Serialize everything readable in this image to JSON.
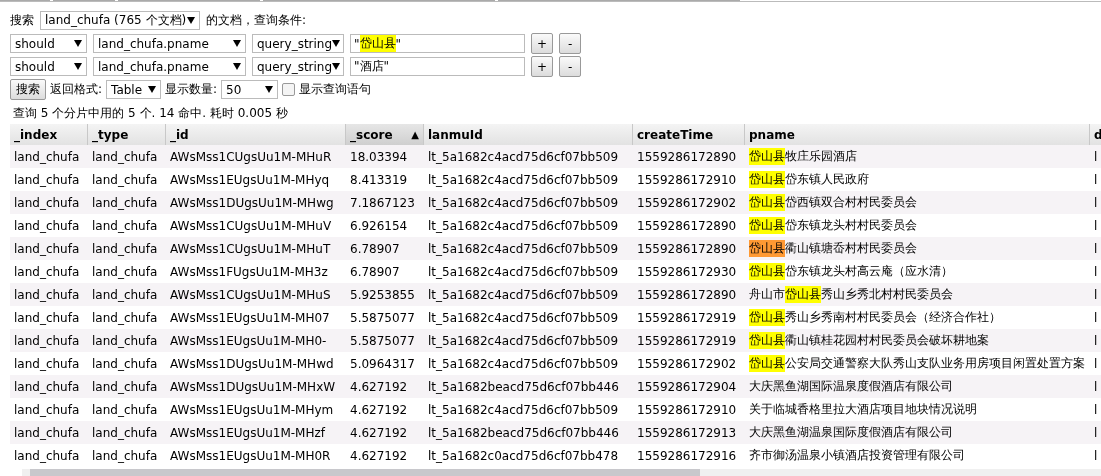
{
  "search_bar": {
    "label": "搜索",
    "index_select": "land_chufa (765 个文档)",
    "suffix": "的文档，查询条件:"
  },
  "conditions": [
    {
      "occur": "should",
      "field": "land_chufa.pname",
      "query_type": "query_string",
      "value": [
        {
          "text": "\""
        },
        {
          "text": "岱山县",
          "color": "#ffff00"
        },
        {
          "text": "\""
        }
      ],
      "add": "+",
      "remove": "-"
    },
    {
      "occur": "should",
      "field": "land_chufa.pname",
      "query_type": "query_string",
      "value": [
        {
          "text": "\"酒店\""
        }
      ],
      "add": "+",
      "remove": "-"
    }
  ],
  "options": {
    "search_button": "搜索",
    "format_label": "返回格式:",
    "format": "Table",
    "size_label": "显示数量:",
    "size": "50",
    "show_query": {
      "label": "显示查询语句",
      "checked": false
    }
  },
  "status": "查询 5 个分片中用的 5 个. 14 命中. 耗时 0.005 秒",
  "table": {
    "columns": [
      {
        "label": "_index",
        "sorted": false
      },
      {
        "label": "_type",
        "sorted": false
      },
      {
        "label": "_id",
        "sorted": false
      },
      {
        "label": "_score",
        "sorted": true,
        "sort_mark": "▲"
      },
      {
        "label": "lanmuId",
        "sorted": false
      },
      {
        "label": "createTime",
        "sorted": false
      },
      {
        "label": "pname",
        "sorted": false
      },
      {
        "label": "d",
        "sorted": false
      }
    ],
    "rows": [
      {
        "cells": [
          "land_chufa",
          "land_chufa",
          "AWsMss1CUgsUu1M-MHuR",
          "18.03394",
          "lt_5a1682c4acd75d6cf07bb509",
          "1559286172890"
        ],
        "pname": [
          {
            "text": "岱山县",
            "color": "#ffff00"
          },
          {
            "text": "牧庄乐园酒店"
          }
        ],
        "column_9": "l"
      },
      {
        "cells": [
          "land_chufa",
          "land_chufa",
          "AWsMss1EUgsUu1M-MHyq",
          "8.413319",
          "lt_5a1682c4acd75d6cf07bb509",
          "1559286172910"
        ],
        "pname": [
          {
            "text": "岱山县",
            "color": "#ffff00"
          },
          {
            "text": "岱东镇人民政府"
          }
        ],
        "column_9": "l"
      },
      {
        "cells": [
          "land_chufa",
          "land_chufa",
          "AWsMss1DUgsUu1M-MHwg",
          "7.1867123",
          "lt_5a1682c4acd75d6cf07bb509",
          "1559286172902"
        ],
        "pname": [
          {
            "text": "岱山县",
            "color": "#ffff00"
          },
          {
            "text": "岱西镇双合村村民委员会"
          }
        ],
        "column_9": "l"
      },
      {
        "cells": [
          "land_chufa",
          "land_chufa",
          "AWsMss1CUgsUu1M-MHuV",
          "6.926154",
          "lt_5a1682c4acd75d6cf07bb509",
          "1559286172890"
        ],
        "pname": [
          {
            "text": "岱山县",
            "color": "#ffff00"
          },
          {
            "text": "岱东镇龙头村村民委员会"
          }
        ],
        "column_9": "l"
      },
      {
        "cells": [
          "land_chufa",
          "land_chufa",
          "AWsMss1CUgsUu1M-MHuT",
          "6.78907",
          "lt_5a1682c4acd75d6cf07bb509",
          "1559286172890"
        ],
        "pname": [
          {
            "text": "岱山县",
            "color": "#ff9933"
          },
          {
            "text": "衢山镇塘岙村村民委员会"
          }
        ],
        "column_9": "l"
      },
      {
        "cells": [
          "land_chufa",
          "land_chufa",
          "AWsMss1FUgsUu1M-MH3z",
          "6.78907",
          "lt_5a1682c4acd75d6cf07bb509",
          "1559286172930"
        ],
        "pname": [
          {
            "text": "岱山县",
            "color": "#ffff00"
          },
          {
            "text": "岱东镇龙头村高云庵（应水清）"
          }
        ],
        "column_9": "l"
      },
      {
        "cells": [
          "land_chufa",
          "land_chufa",
          "AWsMss1CUgsUu1M-MHuS",
          "5.9253855",
          "lt_5a1682c4acd75d6cf07bb509",
          "1559286172890"
        ],
        "pname": [
          {
            "text": "舟山市"
          },
          {
            "text": "岱山县",
            "color": "#ffff00"
          },
          {
            "text": "秀山乡秀北村村民委员会"
          }
        ],
        "column_9": "l"
      },
      {
        "cells": [
          "land_chufa",
          "land_chufa",
          "AWsMss1EUgsUu1M-MH07",
          "5.5875077",
          "lt_5a1682c4acd75d6cf07bb509",
          "1559286172919"
        ],
        "pname": [
          {
            "text": "岱山县",
            "color": "#ffff00"
          },
          {
            "text": "秀山乡秀南村村民委员会（经济合作社）"
          }
        ],
        "column_9": "l"
      },
      {
        "cells": [
          "land_chufa",
          "land_chufa",
          "AWsMss1EUgsUu1M-MH0-",
          "5.5875077",
          "lt_5a1682c4acd75d6cf07bb509",
          "1559286172919"
        ],
        "pname": [
          {
            "text": "岱山县",
            "color": "#ffff00"
          },
          {
            "text": "衢山镇桂花园村村民委员会破坏耕地案"
          }
        ],
        "column_9": "l"
      },
      {
        "cells": [
          "land_chufa",
          "land_chufa",
          "AWsMss1DUgsUu1M-MHwd",
          "5.0964317",
          "lt_5a1682c4acd75d6cf07bb509",
          "1559286172902"
        ],
        "pname": [
          {
            "text": "岱山县",
            "color": "#ffff00"
          },
          {
            "text": "公安局交通警察大队秀山支队业务用房项目闲置处置方案"
          }
        ],
        "column_9": "l"
      },
      {
        "cells": [
          "land_chufa",
          "land_chufa",
          "AWsMss1DUgsUu1M-MHxW",
          "4.627192",
          "lt_5a1682beacd75d6cf07bb446",
          "1559286172904"
        ],
        "pname": [
          {
            "text": "大庆黑鱼湖国际温泉度假酒店有限公司"
          }
        ],
        "column_9": "l"
      },
      {
        "cells": [
          "land_chufa",
          "land_chufa",
          "AWsMss1EUgsUu1M-MHym",
          "4.627192",
          "lt_5a1682c4acd75d6cf07bb509",
          "1559286172910"
        ],
        "pname": [
          {
            "text": "关于临城香格里拉大酒店项目地块情况说明"
          }
        ],
        "column_9": "l"
      },
      {
        "cells": [
          "land_chufa",
          "land_chufa",
          "AWsMss1EUgsUu1M-MHzf",
          "4.627192",
          "lt_5a1682beacd75d6cf07bb446",
          "1559286172913"
        ],
        "pname": [
          {
            "text": "大庆黑鱼湖温泉国际度假酒店有限公司"
          }
        ],
        "column_9": "l"
      },
      {
        "cells": [
          "land_chufa",
          "land_chufa",
          "AWsMss1EUgsUu1M-MH0R",
          "4.627192",
          "lt_5a1682c0acd75d6cf07bb478",
          "1559286172916"
        ],
        "pname": [
          {
            "text": "齐市御汤温泉小镇酒店投资管理有限公司"
          }
        ],
        "column_9": "l"
      }
    ]
  }
}
